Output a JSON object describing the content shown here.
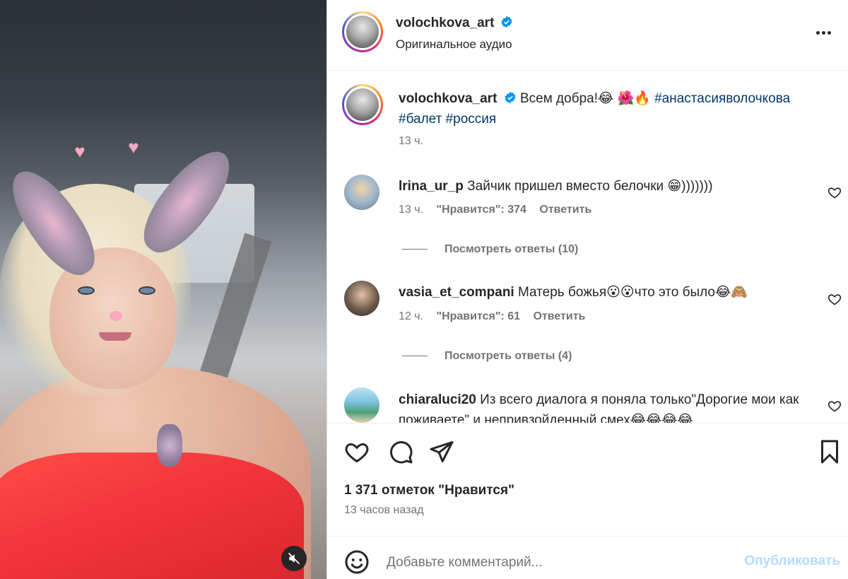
{
  "media": {
    "mute_icon": "speaker-muted-icon",
    "description": "",
    "colors": {
      "dress": "#f0343a",
      "ears": "#8e8595"
    }
  },
  "header": {
    "username": "volochkova_art",
    "subtitle": "Оригинальное аудио",
    "verified_icon": "verified-badge-icon",
    "more_icon": "more-horizontal-icon"
  },
  "caption": {
    "username": "volochkova_art",
    "text": "Всем добра!😂 🌺🔥",
    "hashtag1": "#анастасияволочкова",
    "hashtag2": "#балет",
    "hashtag3": "#россия",
    "time": "13 ч."
  },
  "comments": [
    {
      "username": "lrina_ur_p",
      "text": "Зайчик пришел вместо белочки 😁)))))))",
      "time": "13 ч.",
      "likes": "\"Нравится\": 374",
      "reply": "Ответить",
      "replies": "Посмотреть ответы (10)"
    },
    {
      "username": "vasia_et_compani",
      "text": "Матерь божья😮😮что это было😂🙈",
      "time": "12 ч.",
      "likes": "\"Нравится\": 61",
      "reply": "Ответить",
      "replies": "Посмотреть ответы (4)"
    },
    {
      "username": "chiaraluci20",
      "text": "Из всего диалога я поняла только\"Дорогие мои как поживаете\" и непривзойденный смех😂😂😂😂"
    }
  ],
  "actions": {
    "like_icon": "heart-icon",
    "comment_icon": "comment-icon",
    "share_icon": "paper-plane-icon",
    "save_icon": "bookmark-icon",
    "likes": "1 371 отметок \"Нравится\"",
    "time": "13 часов назад"
  },
  "add_comment": {
    "emoji_icon": "emoji-icon",
    "placeholder": "Добавьте комментарий...",
    "publish": "Опубликовать"
  },
  "colors": {
    "text": "#262626",
    "secondary": "#737373",
    "hashtag": "#00376b",
    "publish_disabled": "#b3dbff",
    "border": "#dbdbdb"
  }
}
